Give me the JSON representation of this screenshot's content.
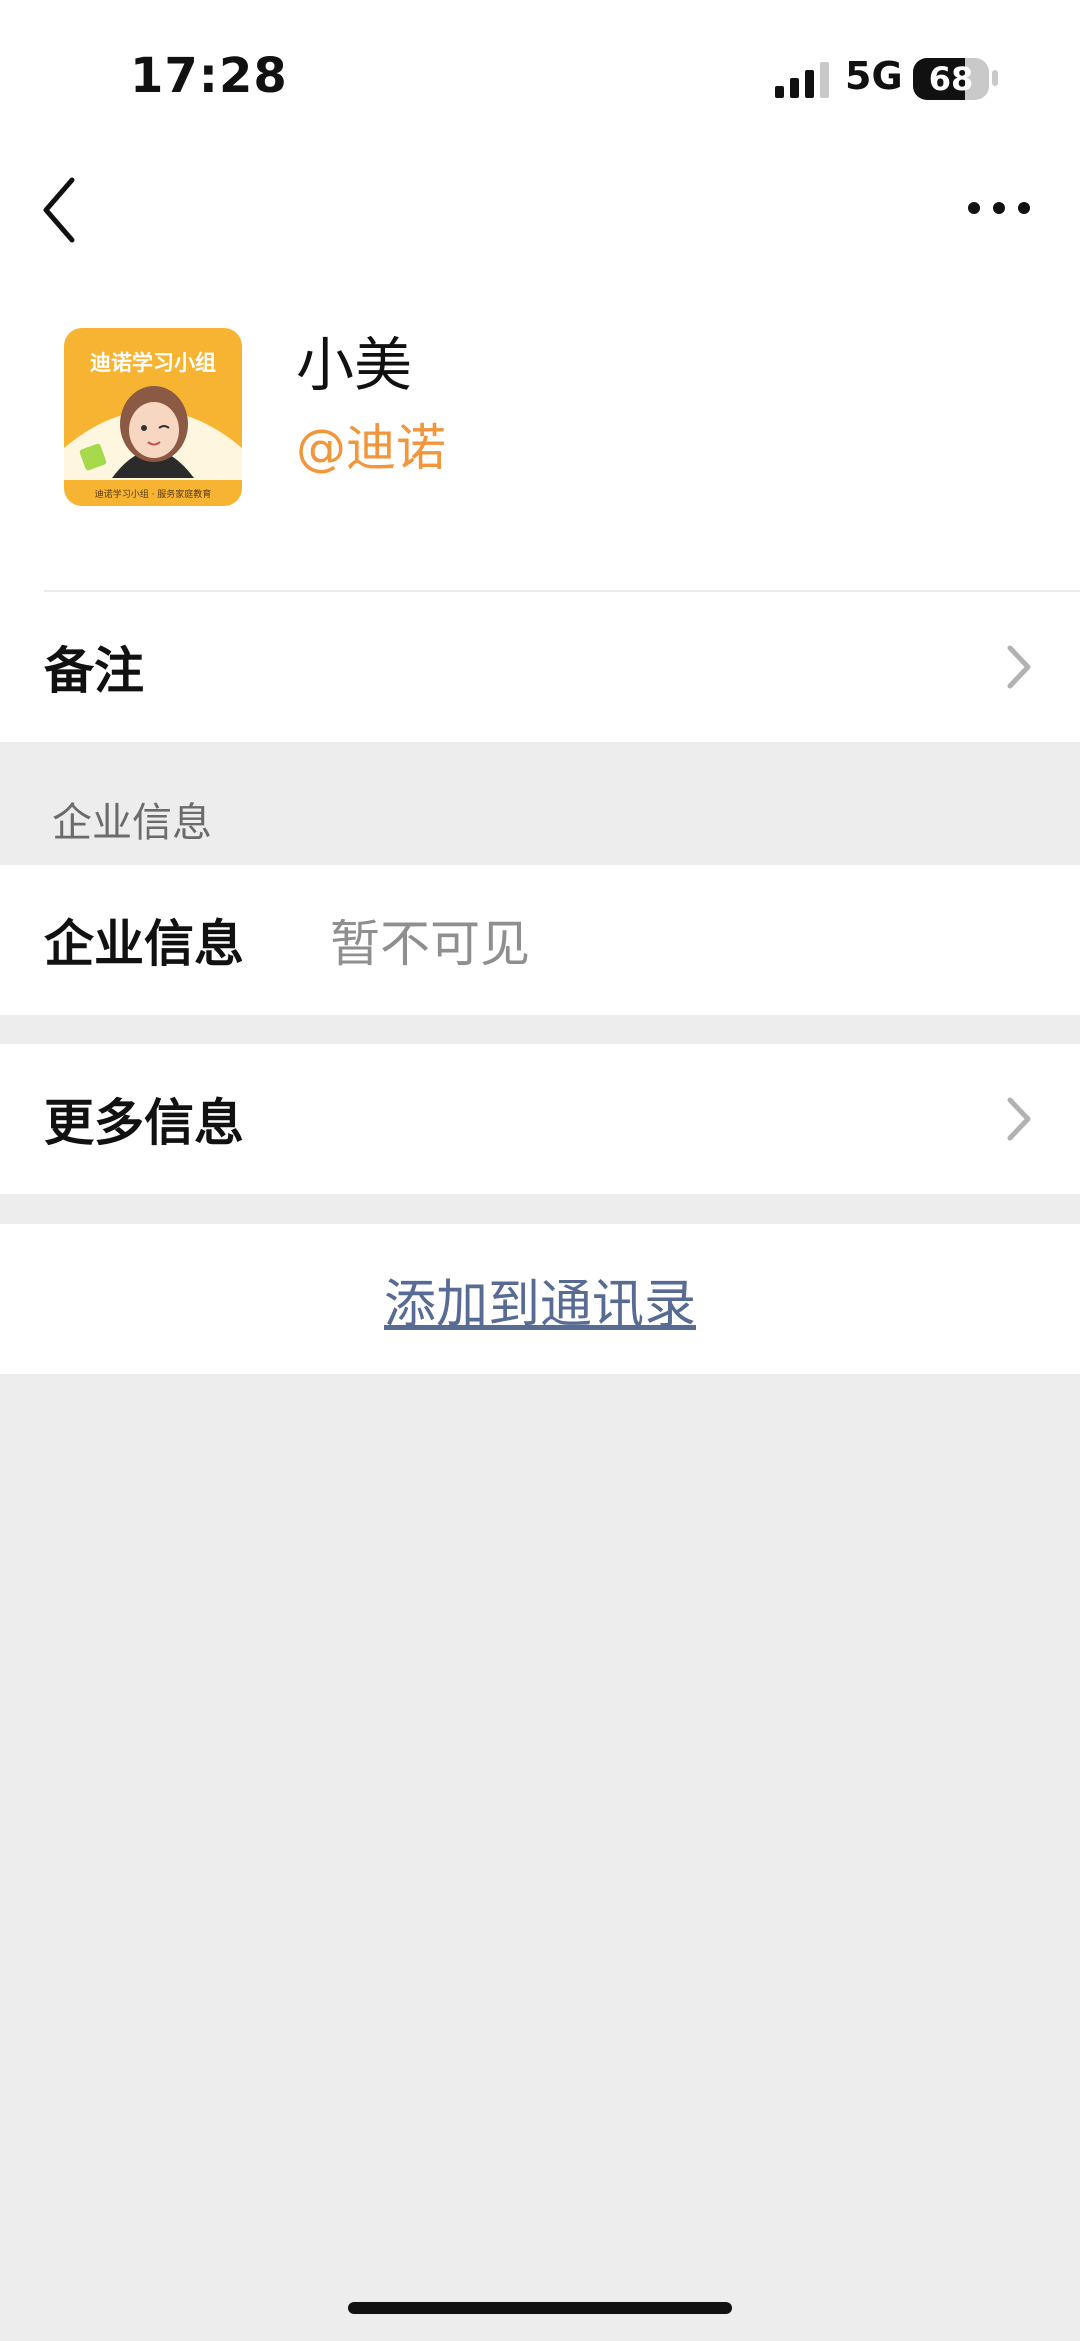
{
  "status_bar": {
    "time": "17:28",
    "network": "5G",
    "battery": 68,
    "battery_label": "68"
  },
  "nav": {
    "back_icon": "chevron-left-icon",
    "more_icon": "ellipsis-icon"
  },
  "profile": {
    "name": "小美",
    "company": "@迪诺",
    "avatar": {
      "banner_text": "迪诺学习小组",
      "footer_text": "迪诺学习小组 · 服务家庭教育",
      "background_color": "#f7b432"
    }
  },
  "rows": {
    "remark_label": "备注",
    "section_title": "企业信息",
    "enterprise_label": "企业信息",
    "enterprise_value": "暂不可见",
    "more_info_label": "更多信息"
  },
  "actions": {
    "add_to_contacts": "添加到通讯录"
  },
  "colors": {
    "accent_orange": "#f3953b",
    "link_blue": "#576b95",
    "page_gray": "#ededed"
  }
}
